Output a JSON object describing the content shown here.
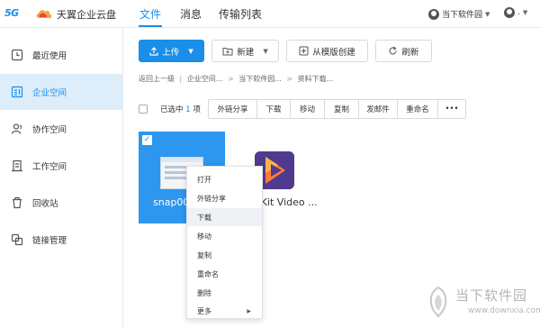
{
  "header": {
    "brand_5g": "5G",
    "app_title": "天翼企业云盘",
    "nav": [
      "文件",
      "消息",
      "传输列表"
    ],
    "org": "当下软件园",
    "user": "."
  },
  "sidebar": {
    "items": [
      {
        "label": "最近使用",
        "icon": "clock-icon"
      },
      {
        "label": "企业空间",
        "icon": "enterprise-icon"
      },
      {
        "label": "协作空间",
        "icon": "collab-icon"
      },
      {
        "label": "工作空间",
        "icon": "workspace-icon"
      },
      {
        "label": "回收站",
        "icon": "trash-icon"
      },
      {
        "label": "链接管理",
        "icon": "link-icon"
      }
    ]
  },
  "toolbar": {
    "upload": "上传",
    "new": "新建",
    "template": "从模版创建",
    "refresh": "刷新"
  },
  "breadcrumb": [
    "返回上一级",
    "企业空间...",
    "当下软件园...",
    "资料下载..."
  ],
  "selection": {
    "prefix": "已选中",
    "count": "1",
    "suffix": "项"
  },
  "actions": [
    "外链分享",
    "下载",
    "移动",
    "复制",
    "发邮件",
    "重命名",
    "•••"
  ],
  "files": [
    {
      "name": "snap000...",
      "selected": true
    },
    {
      "name": "sKit Video ...",
      "selected": false
    }
  ],
  "context_menu": [
    "打开",
    "外链分享",
    "下载",
    "移动",
    "复制",
    "重命名",
    "删除",
    "更多"
  ],
  "watermark": {
    "title": "当下软件园",
    "url": "www.downxia.com"
  },
  "colors": {
    "accent": "#1a8ee8",
    "sidebar_active_bg": "#ddeefa",
    "tile_selected": "#2d96ef",
    "app_icon": "#5a3c96"
  }
}
